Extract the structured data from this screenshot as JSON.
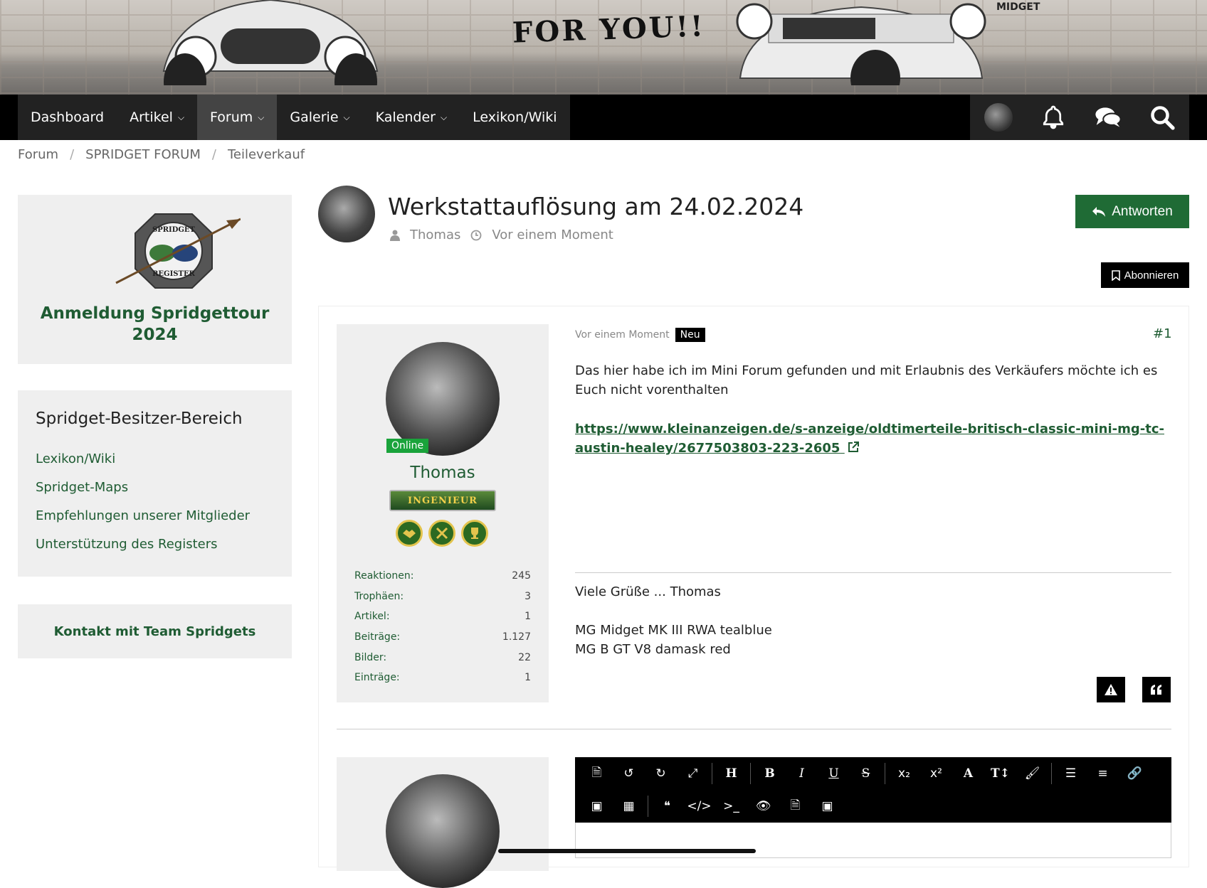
{
  "banner": {
    "slogan": "FOR YOU!!",
    "brand": "MIDGET"
  },
  "nav": {
    "items": [
      {
        "label": "Dashboard",
        "dropdown": false
      },
      {
        "label": "Artikel",
        "dropdown": true
      },
      {
        "label": "Forum",
        "dropdown": true,
        "active": true
      },
      {
        "label": "Galerie",
        "dropdown": true
      },
      {
        "label": "Kalender",
        "dropdown": true
      },
      {
        "label": "Lexikon/Wiki",
        "dropdown": false
      }
    ],
    "icons": [
      "user-avatar",
      "bell-icon",
      "comments-icon",
      "search-icon"
    ]
  },
  "breadcrumb": [
    "Forum",
    "SPRIDGET FORUM",
    "Teileverkauf"
  ],
  "sidebar": {
    "logo_text": [
      "SPRIDGET",
      "REGISTER"
    ],
    "logo_title": "Anmeldung Spridgettour 2024",
    "owner_title": "Spridget-Besitzer-Bereich",
    "owner_links": [
      "Lexikon/Wiki",
      "Spridget-Maps",
      "Empfehlungen unserer Mitglieder",
      "Unterstützung des Registers"
    ],
    "contact": "Kontakt mit Team Spridgets"
  },
  "thread": {
    "title": "Werkstattauflösung am 24.02.2024",
    "author": "Thomas",
    "time": "Vor einem Moment",
    "reply_label": "Antworten",
    "subscribe_label": "Abonnieren"
  },
  "post": {
    "date": "Vor einem Moment",
    "new_badge": "Neu",
    "number": "#1",
    "body": "Das hier habe ich im Mini Forum gefunden und mit Erlaubnis des Verkäufers möchte ich es Euch nicht vorenthalten",
    "link": "https://www.kleinanzeigen.de/s-anzeige/oldtimerteile-britisch-classic-mini-mg-tc-austin-healey/2677503803-223-2605",
    "signature": "Viele Grüße ... Thomas\n\nMG Midget MK III RWA tealblue\nMG B GT V8 damask red"
  },
  "user": {
    "status": "Online",
    "name": "Thomas",
    "rank": "INGENIEUR",
    "stats": [
      {
        "label": "Reaktionen:",
        "value": "245"
      },
      {
        "label": "Trophäen:",
        "value": "3"
      },
      {
        "label": "Artikel:",
        "value": "1"
      },
      {
        "label": "Beiträge:",
        "value": "1.127"
      },
      {
        "label": "Bilder:",
        "value": "22"
      },
      {
        "label": "Einträge:",
        "value": "1"
      }
    ]
  },
  "colors": {
    "accent": "#1f5c33",
    "button": "#1f6b35",
    "nav_bg": "#000000",
    "online": "#1aa33b"
  }
}
